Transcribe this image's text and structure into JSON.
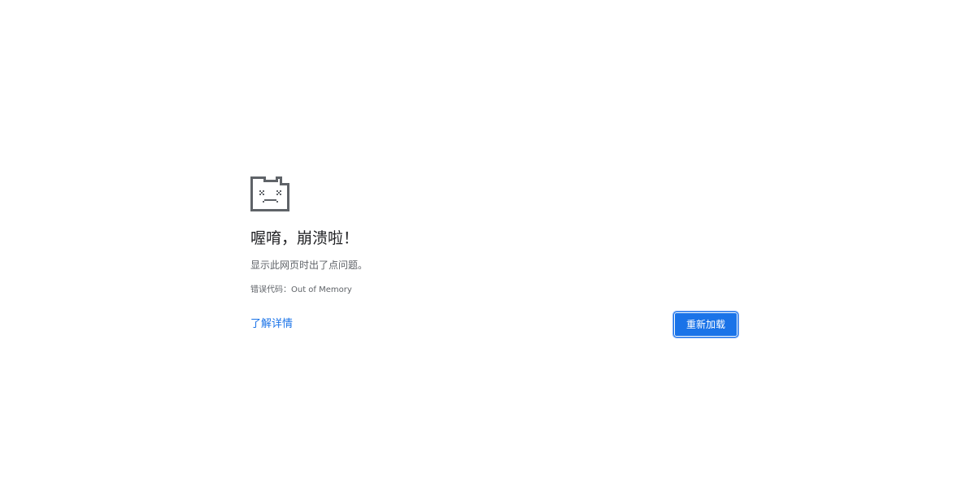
{
  "crash": {
    "icon": "sad-tab-icon",
    "title": "喔唷，崩溃啦！",
    "message": "显示此网页时出了点问题。",
    "error_code": "错误代码：Out of Memory",
    "learn_more_label": "了解详情",
    "reload_label": "重新加载"
  },
  "colors": {
    "accent": "#1a73e8",
    "icon": "#5f6368",
    "text_primary": "#202124",
    "text_secondary": "#5f6368"
  }
}
